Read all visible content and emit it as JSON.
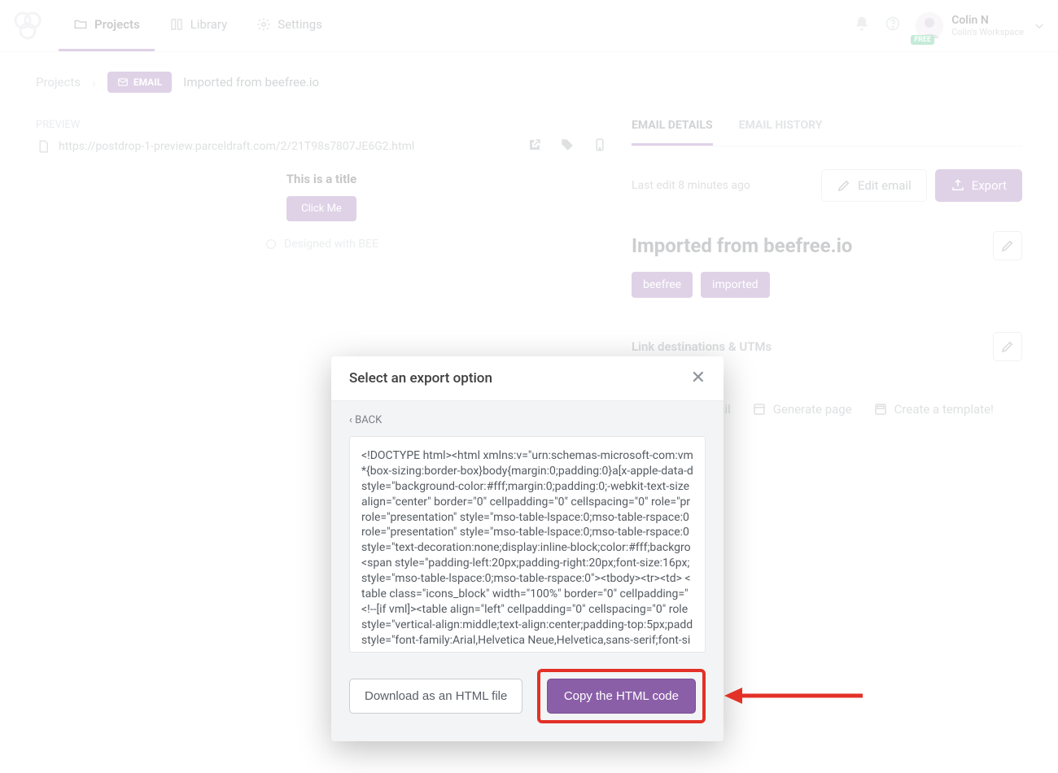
{
  "topnav": {
    "tabs": [
      {
        "label": "Projects",
        "active": true
      },
      {
        "label": "Library",
        "active": false
      },
      {
        "label": "Settings",
        "active": false
      }
    ],
    "user": {
      "name": "Colin N",
      "sub": "Colin's Workspace",
      "badge": "FREE"
    }
  },
  "breadcrumb": {
    "root": "Projects",
    "badge": "EMAIL",
    "title": "Imported from beefree.io"
  },
  "preview": {
    "label": "PREVIEW",
    "url": "https://postdrop-1-preview.parceldraft.com/2/21T98s7807JE6G2.html",
    "email_title": "This is a title",
    "email_button": "Click Me",
    "designed": "Designed with BEE"
  },
  "details": {
    "tabs": [
      {
        "label": "EMAIL DETAILS",
        "active": true
      },
      {
        "label": "EMAIL HISTORY",
        "active": false
      }
    ],
    "last_edit": "Last edit 8 minutes ago",
    "edit_button": "Edit email",
    "export_button": "Export",
    "title": "Imported from beefree.io",
    "tags": [
      "beefree",
      "imported"
    ],
    "section": "Link destinations & UTMs",
    "under_links": [
      "Transfer email",
      "Generate page",
      "Create a template!"
    ]
  },
  "modal": {
    "title": "Select an export option",
    "back": "‹ BACK",
    "code": "<!DOCTYPE html><html xmlns:v=\"urn:schemas-microsoft-com:vm *{box-sizing:border-box}body{margin:0;padding:0}a[x-apple-data-d style=\"background-color:#fff;margin:0;padding:0;-webkit-text-size align=\"center\" border=\"0\" cellpadding=\"0\" cellspacing=\"0\" role=\"pr role=\"presentation\" style=\"mso-table-lspace:0;mso-table-rspace:0 role=\"presentation\" style=\"mso-table-lspace:0;mso-table-rspace:0 style=\"text-decoration:none;display:inline-block;color:#fff;backgro <span style=\"padding-left:20px;padding-right:20px;font-size:16px; style=\"mso-table-lspace:0;mso-table-rspace:0\"><tbody><tr><td> <table class=\"icons_block\" width=\"100%\" border=\"0\" cellpadding=\" <!--[if vml]><table align=\"left\" cellpadding=\"0\" cellspacing=\"0\" role style=\"vertical-align:middle;text-align:center;padding-top:5px;padd style=\"font-family:Arial,Helvetica Neue,Helvetica,sans-serif;font-si",
    "download": "Download as an HTML file",
    "copy": "Copy the HTML code"
  }
}
